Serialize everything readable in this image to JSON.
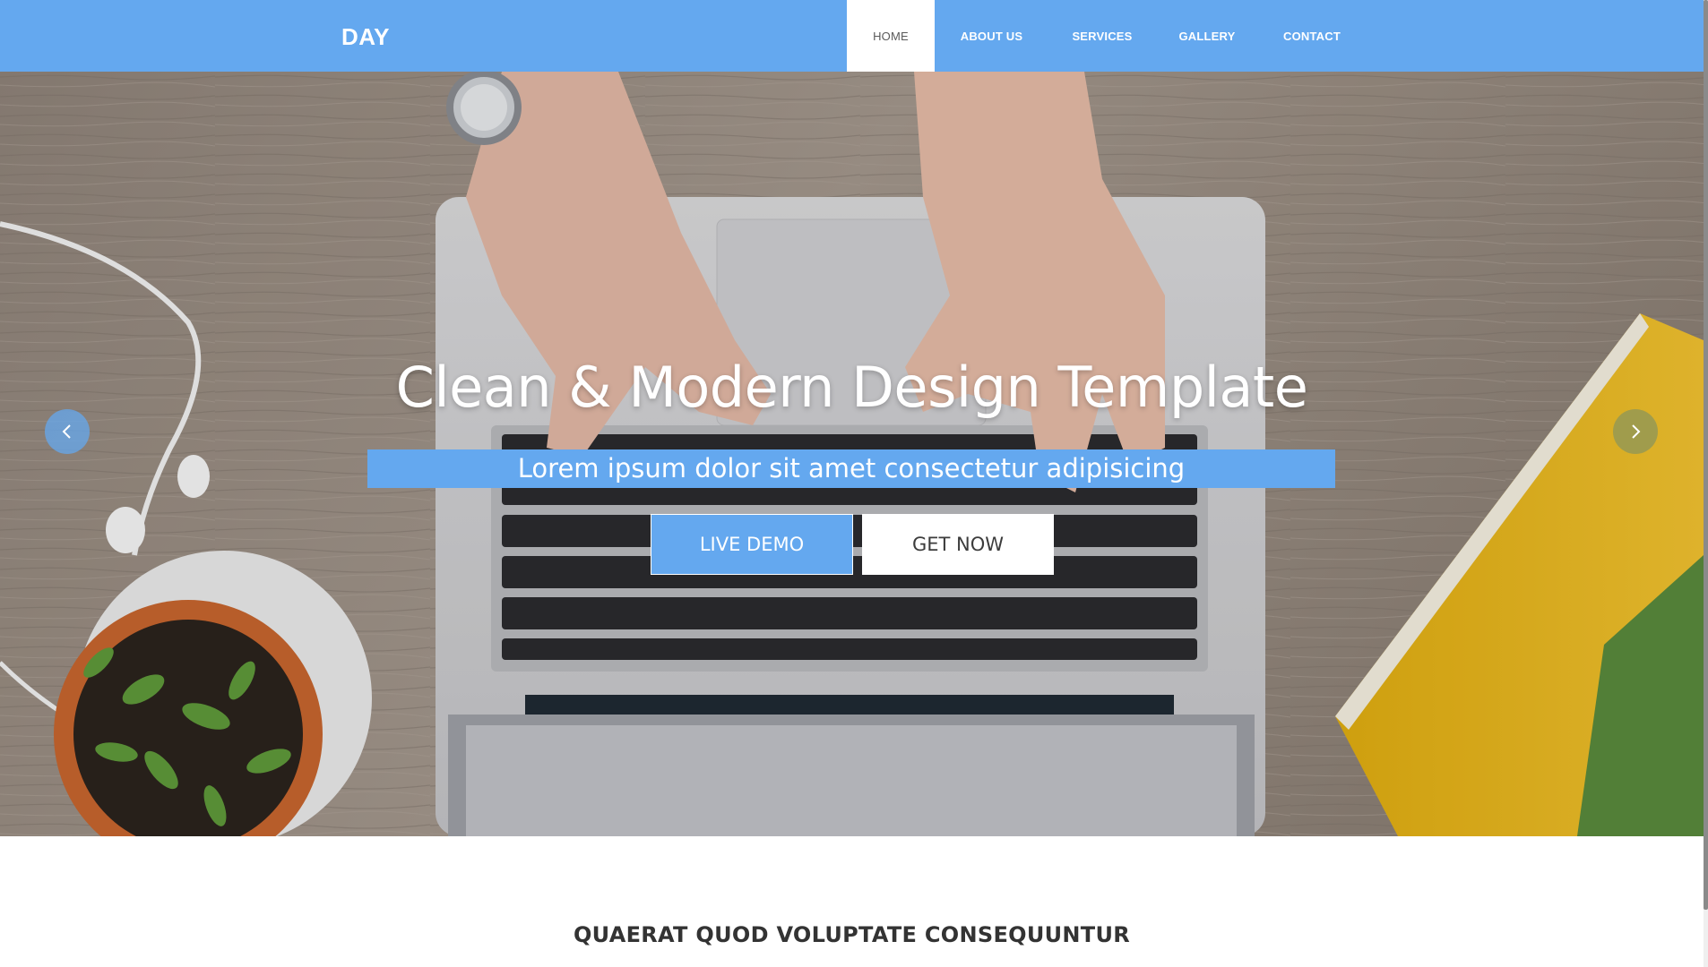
{
  "brand": {
    "name": "DAY"
  },
  "nav": {
    "items": [
      {
        "label": "HOME",
        "active": true
      },
      {
        "label": "ABOUT US",
        "active": false
      },
      {
        "label": "SERVICES",
        "active": false
      },
      {
        "label": "GALLERY",
        "active": false
      },
      {
        "label": "CONTACT",
        "active": false
      }
    ]
  },
  "hero": {
    "title": "Clean & Modern Design Template",
    "subtitle": "Lorem ipsum dolor sit amet consectetur adipisicing",
    "buttons": {
      "live_demo": "LIVE DEMO",
      "get_now": "GET NOW"
    },
    "background_description_icon": "desk-laptop-photo",
    "carousel": {
      "prev_icon": "chevron-left-icon",
      "next_icon": "chevron-right-icon"
    }
  },
  "section": {
    "heading": "QUAERAT QUOD VOLUPTATE CONSEQUUNTUR"
  },
  "colors": {
    "accent": "#64a8ef",
    "white": "#ffffff",
    "text_dark": "#333333"
  }
}
